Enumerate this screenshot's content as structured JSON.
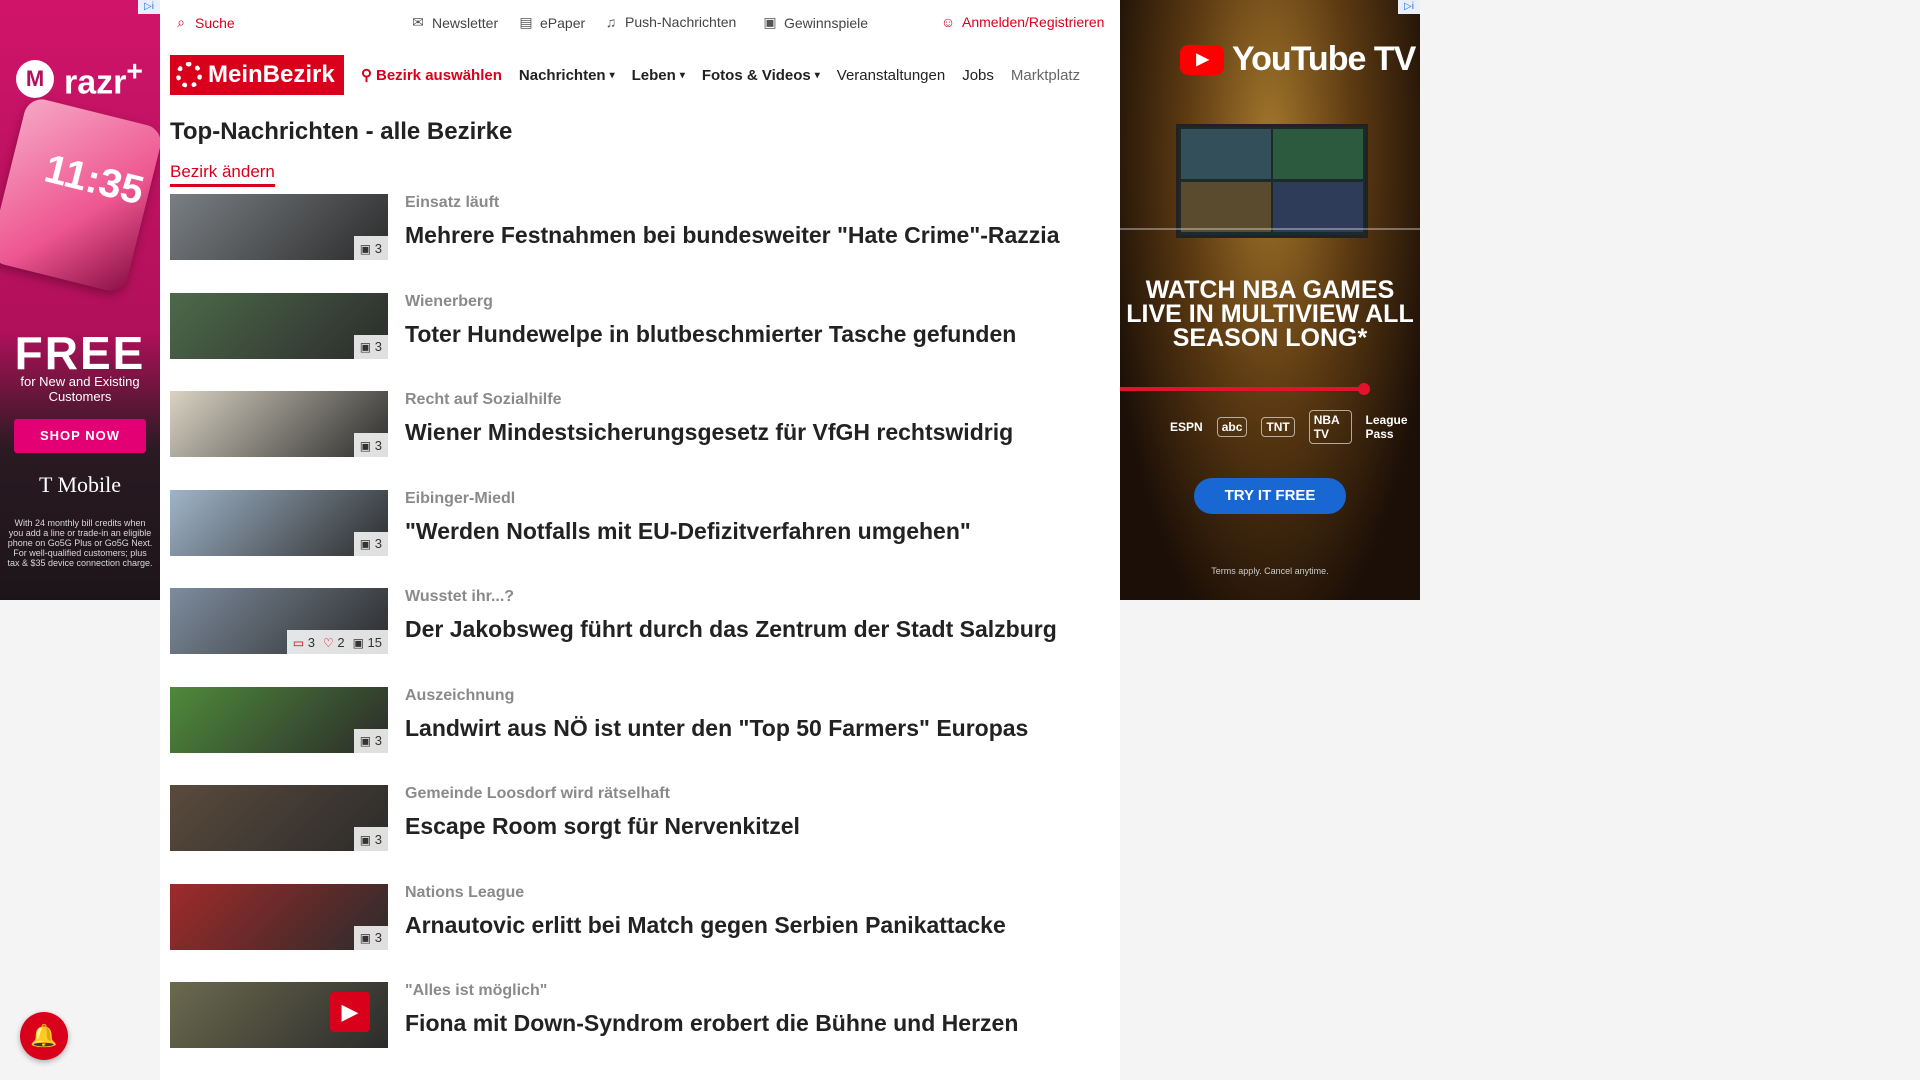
{
  "left_ad": {
    "brand": "razr",
    "brand_sup": "+",
    "phone_time": "11:35",
    "headline": "FREE",
    "subline": "for New and Existing Customers",
    "cta": "SHOP NOW",
    "carrier": "T Mobile",
    "fineprint": "With 24 monthly bill credits when you add a line or trade-in an eligible phone on Go5G Plus or Go5G Next. For well-qualified customers; plus tax & $35 device connection charge."
  },
  "topbar": {
    "search": "Suche",
    "newsletter": "Newsletter",
    "epaper": "ePaper",
    "push": "Push-Nachrichten",
    "games": "Gewinnspiele",
    "login": "Anmelden/Registrieren"
  },
  "nav": {
    "logo": "MeinBezirk",
    "district": "Bezirk auswählen",
    "items": [
      "Nachrichten",
      "Leben",
      "Fotos & Videos",
      "Veranstaltungen",
      "Jobs",
      "Marktplatz"
    ]
  },
  "page": {
    "title": "Top-Nachrichten - alle Bezirke",
    "change_district": "Bezirk ändern"
  },
  "articles": [
    {
      "kicker": "Einsatz läuft",
      "headline": "Mehrere Festnahmen bei bundesweiter \"Hate Crime\"-Razzia",
      "images": "3",
      "color": "#7a7f83"
    },
    {
      "kicker": "Wienerberg",
      "headline": "Toter Hundewelpe in blutbeschmierter Tasche gefunden",
      "images": "3",
      "color": "#4d6a4a"
    },
    {
      "kicker": "Recht auf Sozialhilfe",
      "headline": "Wiener Mindestsicherungsgesetz für VfGH rechtswidrig",
      "images": "3",
      "color": "#d9d3c3"
    },
    {
      "kicker": "Eibinger-Miedl",
      "headline": "\"Werden Notfalls mit EU-Defizitverfahren umgehen\"",
      "images": "3",
      "color": "#9fb4c9"
    },
    {
      "kicker": "Wusstet ihr...?",
      "headline": "Der Jakobsweg führt durch das Zentrum der Stadt Salzburg",
      "comments": "3",
      "likes": "2",
      "images": "15",
      "color": "#7d8c9d"
    },
    {
      "kicker": "Auszeichnung",
      "headline": "Landwirt aus NÖ ist unter den \"Top 50 Farmers\" Europas",
      "images": "3",
      "color": "#4e8a3a"
    },
    {
      "kicker": "Gemeinde Loosdorf wird rätselhaft",
      "headline": "Escape Room sorgt für Nervenkitzel",
      "images": "3",
      "color": "#5a4a3c"
    },
    {
      "kicker": "Nations League",
      "headline": "Arnautovic erlitt bei Match gegen Serbien Panikattacke",
      "images": "3",
      "color": "#a02a2a"
    },
    {
      "kicker": "\"Alles ist möglich\"",
      "headline": "Fiona mit Down-Syndrom erobert die Bühne und Herzen",
      "video": true,
      "color": "#6b6a4e"
    }
  ],
  "right_ad": {
    "brand": "YouTube TV",
    "headline": "WATCH NBA GAMES LIVE IN MULTIVIEW ALL SEASON LONG*",
    "networks": [
      "ESPN",
      "abc",
      "TNT",
      "NBA TV",
      "League Pass"
    ],
    "cta": "TRY IT FREE",
    "terms": "Terms apply. Cancel anytime."
  },
  "colors": {
    "accent": "#d9001b",
    "youtube_red": "#ff0000",
    "cta_blue": "#1967d2",
    "tmobile_magenta": "#e20074"
  },
  "icons": {
    "search": "search-icon",
    "newsletter": "mail-icon",
    "epaper": "newspaper-icon",
    "push": "bell-icon",
    "games": "gift-icon",
    "login": "user-icon",
    "district": "location-pin-icon",
    "images": "image-icon",
    "comments": "comment-icon",
    "likes": "heart-icon",
    "video": "play-icon"
  }
}
